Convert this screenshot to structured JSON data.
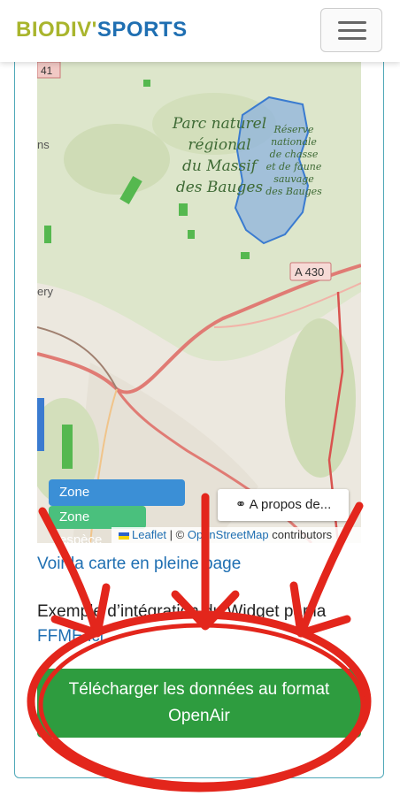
{
  "header": {
    "brand_part1": "BIODIV'",
    "brand_part2": "SPORTS",
    "menu_icon": "hamburger-icon"
  },
  "map": {
    "park_label_lines": [
      "Parc naturel",
      "régional",
      "du Massif",
      "des Bauges"
    ],
    "reserve_label_lines": [
      "Réserve",
      "nationale",
      "de chasse",
      "et de faune",
      "sauvage",
      "des Bauges"
    ],
    "road_label": "A 430",
    "road_number_label": "41",
    "town_fragment_1": "ns",
    "town_fragment_2": "ery",
    "zone_reglementaire_label": "Zone réglementaire",
    "zone_espece_label": "Zone espèce",
    "about_label": "A propos de...",
    "about_icon": "handshake-icon",
    "attribution": {
      "leaflet": "Leaflet",
      "separator": " | © ",
      "osm": "OpenStreetMap",
      "suffix": " contributors"
    }
  },
  "links": {
    "full_page_map": "Voir la carte en pleine page"
  },
  "example": {
    "text": "Exemple d’intégration du Widget par la ",
    "link": "FFME ici"
  },
  "download_button": {
    "line1": "Télécharger les données au format",
    "line2": "OpenAir"
  },
  "colors": {
    "brand_green": "#a9b52d",
    "brand_blue": "#1f6fb2",
    "button_green": "#2e9c3f",
    "annotation_red": "#e3261c",
    "card_border": "#4fa8b8"
  }
}
